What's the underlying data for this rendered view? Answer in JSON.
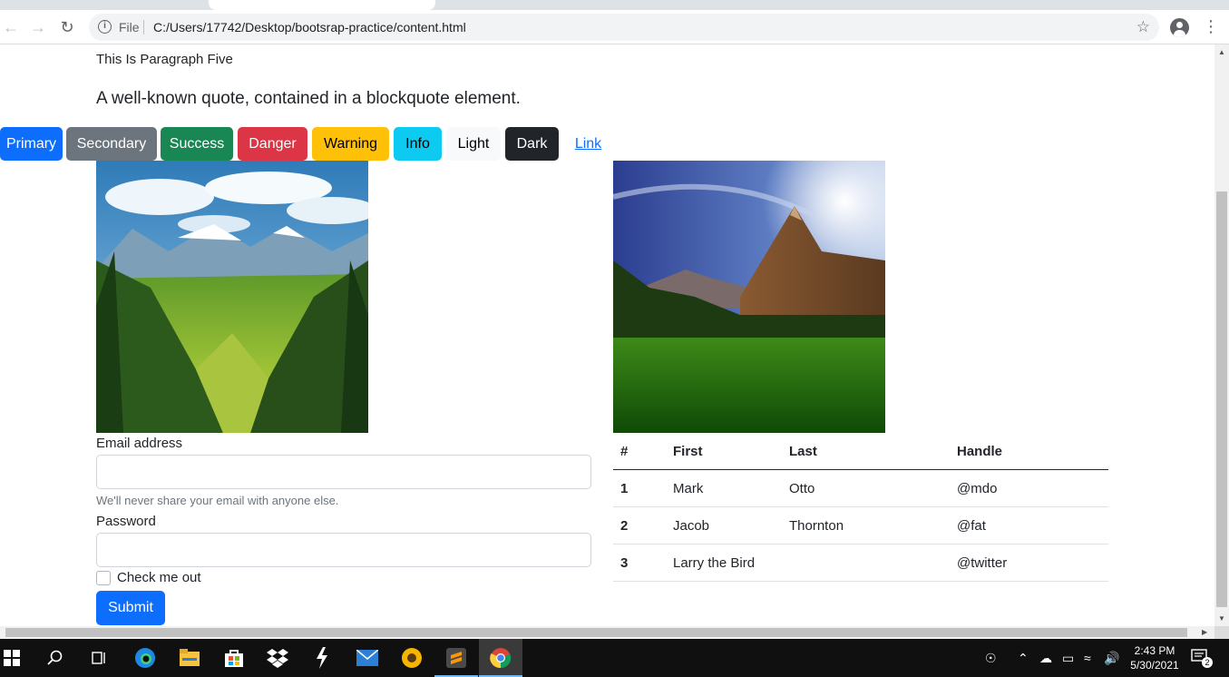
{
  "browser": {
    "url_scheme": "File",
    "url": "C:/Users/17742/Desktop/bootsrap-practice/content.html"
  },
  "page": {
    "paragraph": "This Is Paragraph Five",
    "quote": "A well-known quote, contained in a blockquote element.",
    "buttons": [
      "Primary",
      "Secondary",
      "Success",
      "Danger",
      "Warning",
      "Info",
      "Light",
      "Dark",
      "Link"
    ],
    "form": {
      "email_label": "Email address",
      "email_value": "",
      "email_help": "We'll never share your email with anyone else.",
      "password_label": "Password",
      "password_value": "",
      "check_label": "Check me out",
      "checked": false,
      "submit_label": "Submit"
    },
    "table": {
      "headers": [
        "#",
        "First",
        "Last",
        "Handle"
      ],
      "rows": [
        [
          "1",
          "Mark",
          "Otto",
          "@mdo"
        ],
        [
          "2",
          "Jacob",
          "Thornton",
          "@fat"
        ],
        [
          "3",
          "Larry the Bird",
          "",
          "@twitter"
        ]
      ]
    }
  },
  "taskbar": {
    "time": "2:43 PM",
    "date": "5/30/2021",
    "notification_count": "2"
  },
  "colors": {
    "primary": "#0d6efd",
    "secondary": "#6c757d",
    "success": "#198754",
    "danger": "#dc3545",
    "warning": "#ffc107",
    "info": "#0dcaf0",
    "light": "#f8f9fa",
    "dark": "#212529"
  }
}
